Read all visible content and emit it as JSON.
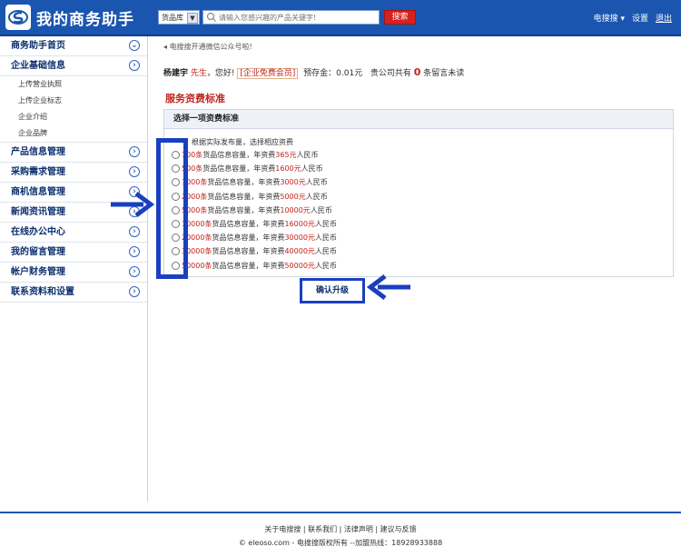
{
  "header": {
    "logo_text": "我的商务助手",
    "search_category": "货品库",
    "search_placeholder": "请输入您感兴趣的产品关键字!",
    "search_button": "搜索",
    "user_menu": "电搜搜",
    "settings": "设置",
    "logout": "退出"
  },
  "sidebar": {
    "items": [
      {
        "label": "商务助手首页"
      },
      {
        "label": "企业基础信息"
      },
      {
        "label": "产品信息管理"
      },
      {
        "label": "采购需求管理"
      },
      {
        "label": "商机信息管理"
      },
      {
        "label": "新闻资讯管理"
      },
      {
        "label": "在线办公中心"
      },
      {
        "label": "我的留言管理"
      },
      {
        "label": "帐户财务管理"
      },
      {
        "label": "联系资料和设置"
      }
    ],
    "subitems": [
      "上传营业执照",
      "上传企业标志",
      "企业介绍",
      "企业品牌"
    ]
  },
  "main": {
    "notice": "电搜搜开通微信公众号啦!",
    "user_name": "杨建宇",
    "user_title": "先生",
    "greeting": "，您好!",
    "member_tag": "[企业免费会员]",
    "deposit_label": "预存金：",
    "deposit_value": "0.01元",
    "msg_prefix": "贵公司共有",
    "msg_count": "0",
    "msg_suffix": "条留言未读",
    "section_title": "服务资费标准",
    "panel_title": "选择一项资费标准",
    "options_note": "根据实际发布量，选择相应资费",
    "options": [
      {
        "qty": "100条",
        "fee": "365元"
      },
      {
        "qty": "500条",
        "fee": "1600元"
      },
      {
        "qty": "1000条",
        "fee": "3000元"
      },
      {
        "qty": "2000条",
        "fee": "5000元"
      },
      {
        "qty": "5000条",
        "fee": "10000元"
      },
      {
        "qty": "10000条",
        "fee": "16000元"
      },
      {
        "qty": "20000条",
        "fee": "30000元"
      },
      {
        "qty": "30000条",
        "fee": "40000元"
      },
      {
        "qty": "50000条",
        "fee": "50000元"
      }
    ],
    "option_mid": "货品信息容量，年资费",
    "option_unit": "人民币",
    "confirm_button": "确认升级"
  },
  "footer": {
    "links": [
      "关于电搜搜",
      "联系我们",
      "法律声明",
      "建议与反馈"
    ],
    "copyright": "© eleoso.com - 电搜搜版权所有 --加盟热线：18928933888"
  },
  "colors": {
    "brand": "#1a56b0",
    "accent_red": "#c0231c",
    "annotation_blue": "#1a3fbf"
  }
}
